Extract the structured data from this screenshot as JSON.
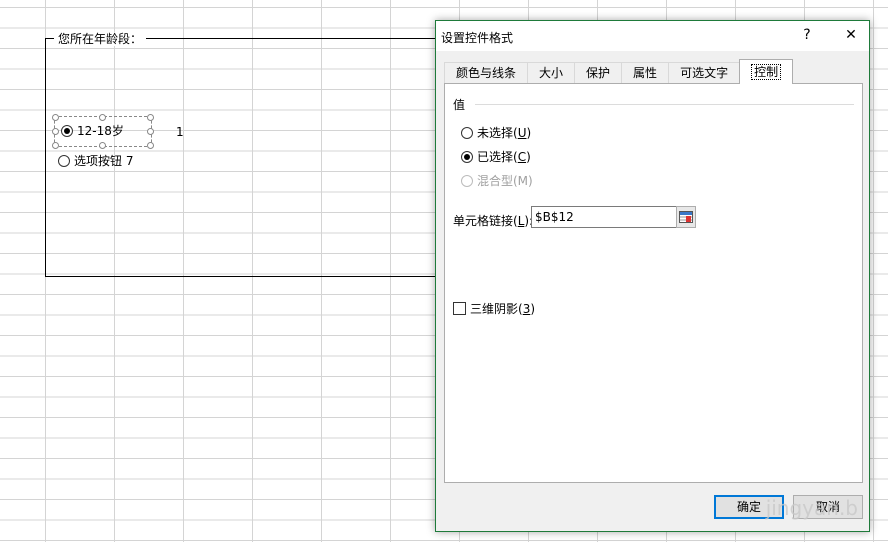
{
  "sheet": {
    "group_title": "您所在年龄段：",
    "option1_label": "12-18岁",
    "option2_label": "选项按钮 7",
    "linked_value": "1"
  },
  "dialog": {
    "title": "设置控件格式",
    "help_label": "?",
    "close_label": "✕",
    "tabs": [
      "颜色与线条",
      "大小",
      "保护",
      "属性",
      "可选文字",
      "控制"
    ],
    "active_tab": "控制",
    "value_section_label": "值",
    "radio_unchecked": {
      "text": "未选择(",
      "key": "U",
      "end": ")"
    },
    "radio_checked": {
      "text": "已选择(",
      "key": "C",
      "end": ")"
    },
    "radio_mixed": "混合型(M)",
    "cell_link_label": {
      "text": "单元格链接(",
      "key": "L",
      "end": "):"
    },
    "cell_link_value": "$B$12",
    "shading_label": {
      "text": "三维阴影(",
      "key": "3",
      "end": ")"
    },
    "ok_label": "确定",
    "cancel_label": "取消"
  },
  "watermark": "jingyan.b"
}
